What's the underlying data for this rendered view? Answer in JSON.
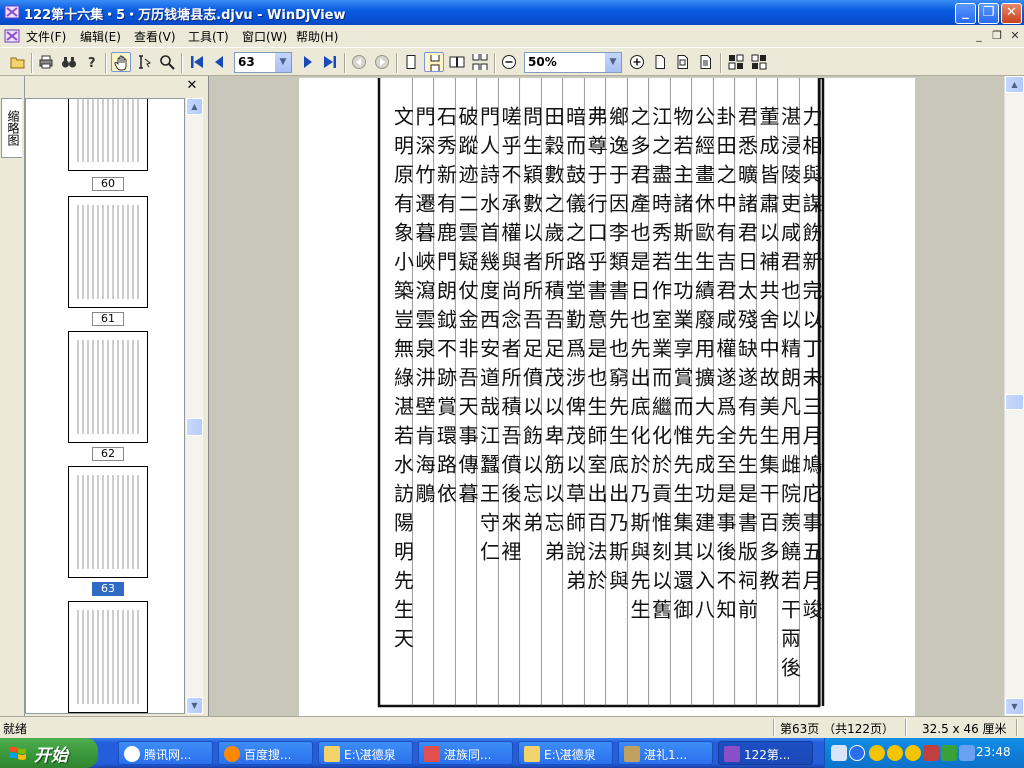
{
  "window": {
    "title": "122第十六集・5・万历钱塘县志.djvu - WinDjView",
    "minimize": "_",
    "maximize": "❐",
    "close": "✕"
  },
  "menu": {
    "items": [
      "文件(F)",
      "编辑(E)",
      "查看(V)",
      "工具(T)",
      "窗口(W)",
      "帮助(H)"
    ],
    "mdi_minimize": "_",
    "mdi_restore": "❐",
    "mdi_close": "✕"
  },
  "toolbar": {
    "page_number": "63",
    "zoom": "50%",
    "active_tool": "hand-tool"
  },
  "sidebar": {
    "tab_label": "缩略图",
    "close": "✕",
    "thumbnails": [
      {
        "label": "60",
        "selected": false
      },
      {
        "label": "61",
        "selected": false
      },
      {
        "label": "62",
        "selected": false
      },
      {
        "label": "63",
        "selected": true
      },
      {
        "label": "64",
        "selected": false
      }
    ]
  },
  "status": {
    "ready": "就绪",
    "page_info": "第63页 （共122页）",
    "dimensions": "32.5 x 46 厘米"
  },
  "taskbar": {
    "start": "开始",
    "tasks": [
      {
        "label": "腾讯网...",
        "icon_color": "#e8a020",
        "active": false
      },
      {
        "label": "百度搜...",
        "icon_color": "#ff8a00",
        "active": false
      },
      {
        "label": "E:\\湛德泉",
        "icon_color": "#f5d36b",
        "active": false
      },
      {
        "label": "湛族同...",
        "icon_color": "#e05050",
        "active": false
      },
      {
        "label": "E:\\湛德泉",
        "icon_color": "#f5d36b",
        "active": false
      },
      {
        "label": "湛礼1...",
        "icon_color": "#c0a060",
        "active": false
      },
      {
        "label": "122第...",
        "icon_color": "#8a4fc8",
        "active": true
      }
    ],
    "clock": "23:48"
  },
  "document": {
    "columns": [
      "力相與謀飭新完以丁未三月鳩庀事五月竣",
      "湛浸陵吏咸君也以精朗凡用雌院羨饒若干兩後",
      "董成皆肅以補共舍中故美生集干百多教",
      "君悉曠諸君日太殘缺遂有先生是書版祠前",
      "卦田之中有吉君咸權遂爲全至是事後不知",
      "公經畫休歐生績廢用擴大先成功建以入八",
      "物若主諸斯生功業享賞而惟先生集其還御",
      "江之盡時秀若作室業而繼化於貢惟刻以舊",
      "之多君產也是日也先出底化於乃斯與先生",
      "鄉逸于因李類書先也窮先生底出乃斯與",
      "弗尊于行口乎書意是也生師室出百法於",
      "暗而鼓儀之路堂勤爲涉俾茂以草師說弟",
      "田穀數之歲所積吾足茂以卑筋以忘弟",
      "問生穎數以者所吾足僨以飭以忘弟",
      "嗟乎不承權與尚念者所積吾僨後來裡",
      "門人詩水首幾度西安道哉江蠶王守仁",
      "破蹤迹二雲疑仗金非吾天事傳暮",
      "石秀新有鹿門朗鉞不跡賞環路依",
      "門深竹遷暮峽瀉雲泉汫壁肯海鵰",
      "文明原有象小築豈無綠湛若水訪陽明先生天"
    ]
  }
}
